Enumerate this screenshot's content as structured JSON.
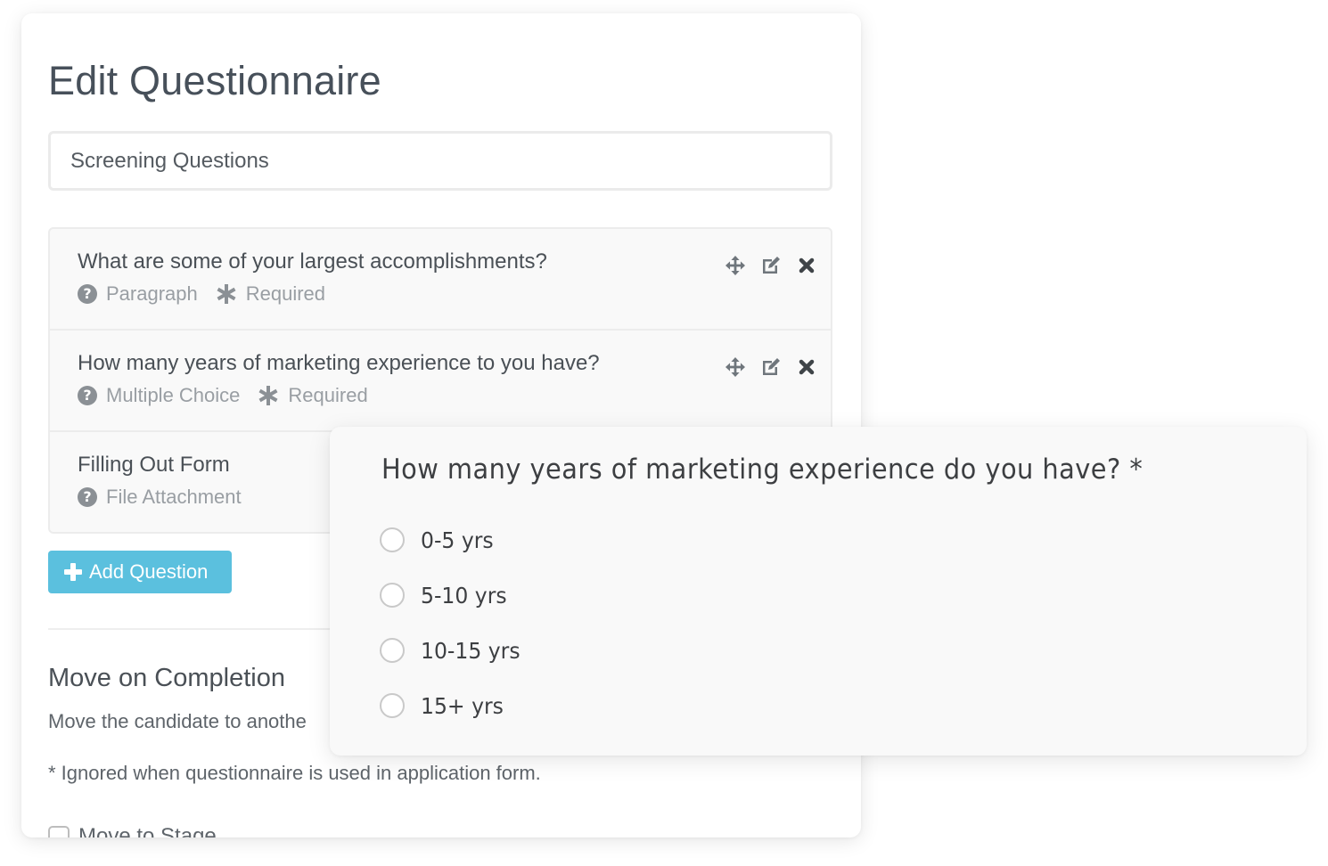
{
  "editor": {
    "title": "Edit Questionnaire",
    "name_input": {
      "value": "Screening Questions",
      "placeholder": ""
    },
    "questions": [
      {
        "title": "What are some of your largest accomplishments?",
        "type": "Paragraph",
        "required_label": "Required",
        "required": true,
        "type_icon": "question-circle-icon",
        "actions": [
          "move-icon",
          "edit-icon",
          "delete-icon"
        ]
      },
      {
        "title": "How many years of marketing experience to you have?",
        "type": "Multiple Choice",
        "required_label": "Required",
        "required": true,
        "type_icon": "question-circle-icon",
        "actions": [
          "move-icon",
          "edit-icon",
          "delete-icon"
        ]
      },
      {
        "title": "Filling Out Form",
        "type": "File Attachment",
        "required": false,
        "type_icon": "question-circle-icon"
      }
    ],
    "add_question_label": "Add Question",
    "section": {
      "title": "Move on Completion",
      "description": "Move the candidate to anothe",
      "note": "* Ignored when questionnaire is used in application form.",
      "checkbox_label": "Move to Stage"
    }
  },
  "preview": {
    "question": "How many years of marketing experience do you have? *",
    "options": [
      "0-5 yrs",
      "5-10 yrs",
      "10-15 yrs",
      "15+ yrs"
    ]
  },
  "colors": {
    "accent": "#5bc0de",
    "text": "#4a5056",
    "muted": "#999ea3"
  }
}
